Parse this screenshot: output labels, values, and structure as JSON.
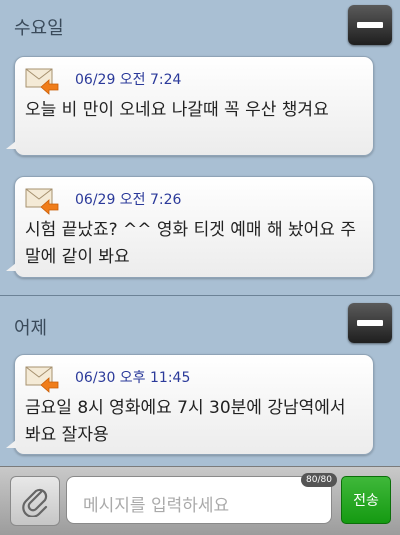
{
  "sections": [
    {
      "day": "수요일",
      "messages": [
        {
          "time": "06/29 오전 7:24",
          "text": "오늘 비 만이 오네요 나갈때 꼭 우산 챙겨요"
        },
        {
          "time": "06/29 오전 7:26",
          "text": "시험 끝났죠? ^^ 영화 티겟 예매 해 놨어요 주말에 같이 봐요"
        }
      ]
    },
    {
      "day": "어제",
      "messages": [
        {
          "time": "06/30 오후 11:45",
          "text": "금요일 8시 영화에요   7시 30분에 강남역에서 봐요 잘자용"
        }
      ]
    }
  ],
  "input": {
    "placeholder": "메시지를 입력하세요",
    "counter": "80/80"
  },
  "send_label": "전송",
  "icons": {
    "envelope": "envelope-reply-icon",
    "attach": "paperclip-icon",
    "collapse": "minus-icon"
  },
  "colors": {
    "send": "#1ea81b",
    "timestamp": "#2b3a9a",
    "background": "#a9bfd3"
  }
}
